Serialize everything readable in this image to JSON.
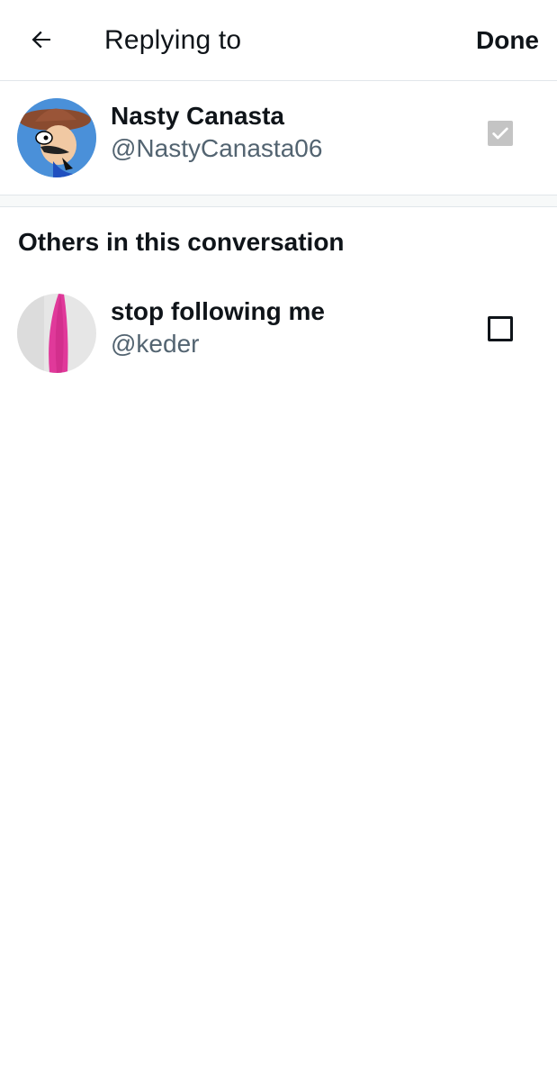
{
  "header": {
    "back_icon": "arrow-left-icon",
    "title": "Replying to",
    "done_label": "Done"
  },
  "primary_user": {
    "name": "Nasty Canasta",
    "handle": "@NastyCanasta06",
    "checked": true,
    "disabled": true
  },
  "others_section": {
    "heading": "Others in this conversation",
    "users": [
      {
        "name": "stop following me",
        "handle": "@keder",
        "checked": false
      }
    ]
  },
  "colors": {
    "text_primary": "#0f1419",
    "text_secondary": "#536471",
    "checkbox_disabled": "#c4c4c4",
    "divider": "#e1e6ea"
  }
}
